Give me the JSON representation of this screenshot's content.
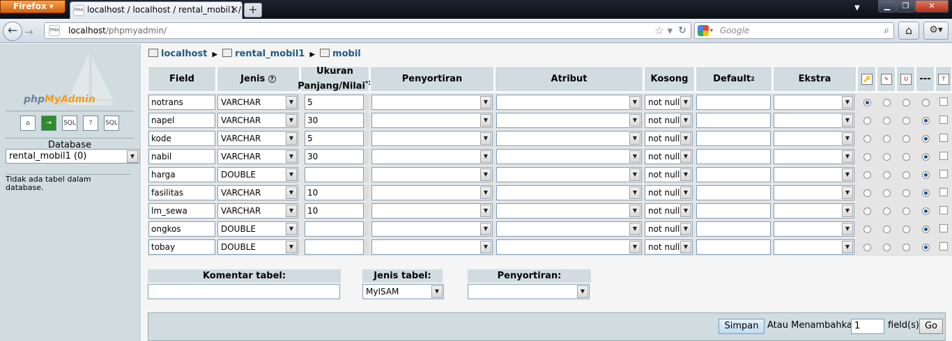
{
  "browser": {
    "app_button": "Firefox",
    "tab_title": "localhost / localhost / rental_mobil1 / m...",
    "tab_favicon": "PMA",
    "new_tab": "+",
    "url_host": "localhost",
    "url_path": "/phpmyadmin/",
    "search_placeholder": "Google"
  },
  "sidebar": {
    "logo_php": "php",
    "logo_myadmin": "MyAdmin",
    "database_label": "Database",
    "database_selected": "rental_mobil1 (0)",
    "no_tables": "Tidak ada tabel dalam database."
  },
  "breadcrumb": {
    "server": "localhost",
    "database": "rental_mobil1",
    "table": "mobil"
  },
  "columns": {
    "field": "Field",
    "type": "Jenis",
    "length_l1": "Ukuran",
    "length_l2": "Panjang/Nilai",
    "length_sup": "*1",
    "collation": "Penyortiran",
    "attributes": "Atribut",
    "null": "Kosong",
    "default": "Default",
    "default_sup": "2",
    "extra": "Ekstra",
    "none": "---"
  },
  "rows": [
    {
      "field": "notrans",
      "type": "VARCHAR",
      "length": "5",
      "null": "not null",
      "key": 0
    },
    {
      "field": "napel",
      "type": "VARCHAR",
      "length": "30",
      "null": "not null",
      "key": 3
    },
    {
      "field": "kode",
      "type": "VARCHAR",
      "length": "5",
      "null": "not null",
      "key": 3
    },
    {
      "field": "nabil",
      "type": "VARCHAR",
      "length": "30",
      "null": "not null",
      "key": 3
    },
    {
      "field": "harga",
      "type": "DOUBLE",
      "length": "",
      "null": "not null",
      "key": 3
    },
    {
      "field": "fasilitas",
      "type": "VARCHAR",
      "length": "10",
      "null": "not null",
      "key": 3
    },
    {
      "field": "lm_sewa",
      "type": "VARCHAR",
      "length": "10",
      "null": "not null",
      "key": 3
    },
    {
      "field": "ongkos",
      "type": "DOUBLE",
      "length": "",
      "null": "not null",
      "key": 3
    },
    {
      "field": "tobay",
      "type": "DOUBLE",
      "length": "",
      "null": "not null",
      "key": 3
    }
  ],
  "table_options": {
    "comment_label": "Komentar tabel:",
    "comment_value": "",
    "engine_label": "Jenis tabel:",
    "engine_value": "MyISAM",
    "collation_label": "Penyortiran:",
    "collation_value": ""
  },
  "footer": {
    "save_button": "Simpan",
    "add_text": "Atau Menambahkan",
    "add_count": "1",
    "fields_text": "field(s)",
    "go_button": "Go"
  },
  "colors": {
    "header_bg": "#d0dce0",
    "link": "#235a81",
    "logo_orange": "#f29d1a"
  }
}
